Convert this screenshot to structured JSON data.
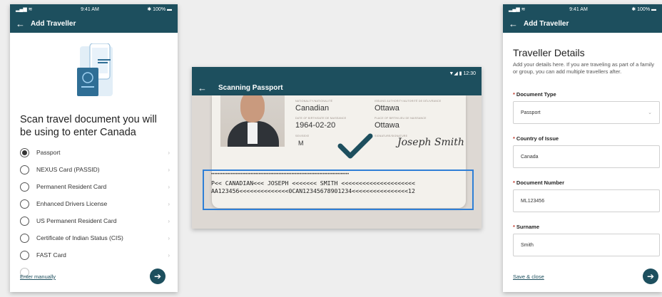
{
  "colors": {
    "primary": "#1d4f5e",
    "accent_box": "#2f7fd6",
    "required": "#c0392b"
  },
  "screen_left": {
    "status": {
      "time": "9:41 AM",
      "battery": "100%"
    },
    "header": {
      "back_icon": "arrow-left-icon",
      "title": "Add Traveller"
    },
    "heading": "Scan travel document you will be using to enter Canada",
    "options": [
      {
        "label": "Passport",
        "selected": true
      },
      {
        "label": "NEXUS Card (PASSID)",
        "selected": false
      },
      {
        "label": "Permanent Resident Card",
        "selected": false
      },
      {
        "label": "Enhanced Drivers License",
        "selected": false
      },
      {
        "label": "US Permanent Resident Card",
        "selected": false
      },
      {
        "label": "Certificate of Indian Status (CIS)",
        "selected": false
      },
      {
        "label": "FAST Card",
        "selected": false
      }
    ],
    "enter_manually": "Enter manually",
    "next_icon": "arrow-right-icon"
  },
  "screen_middle": {
    "status": {
      "time": "12:30"
    },
    "header": {
      "title": "Scanning Passport"
    },
    "passport": {
      "nationality_label": "NATIONALITY/NATIONALITÉ",
      "nationality": "Canadian",
      "authority_label": "ISSUING AUTHORITY/AUTORITÉ DE DÉLIVRANCE",
      "authority": "Ottawa",
      "dob_label": "DATE OF BIRTH/DATE DE NAISSANCE",
      "dob": "1964-02-20",
      "pob_label": "PLACE OF BIRTH/LIEU DE NAISSANCE",
      "pob": "Ottawa",
      "sex_label": "SEX/SEXE",
      "sex": "M",
      "signature_label": "SIGNATURE/SIGNATURE",
      "signature": "Joseph Smith"
    },
    "mrz": {
      "line1": "P<< CANADIAN<<< JOSEPH <<<<<<< SMITH <<<<<<<<<<<<<<<<<<<<<",
      "line2": "AA123456<<<<<<<<<<<<<<0CAN12345678901234<<<<<<<<<<<<<<<<12"
    }
  },
  "screen_right": {
    "status": {
      "time": "9:41 AM",
      "battery": "100%"
    },
    "header": {
      "title": "Add Traveller"
    },
    "title": "Traveller Details",
    "description": "Add your details here. If you are traveling as part of a family or group, you can add multiple travellers after.",
    "fields": [
      {
        "label": "Document Type",
        "value": "Passport",
        "dropdown": true
      },
      {
        "label": "Country of Issue",
        "value": "Canada",
        "dropdown": false
      },
      {
        "label": "Document Number",
        "value": "ML123456",
        "dropdown": false
      },
      {
        "label": "Surname",
        "value": "Smith",
        "dropdown": false
      }
    ],
    "save_close": "Save & close"
  }
}
